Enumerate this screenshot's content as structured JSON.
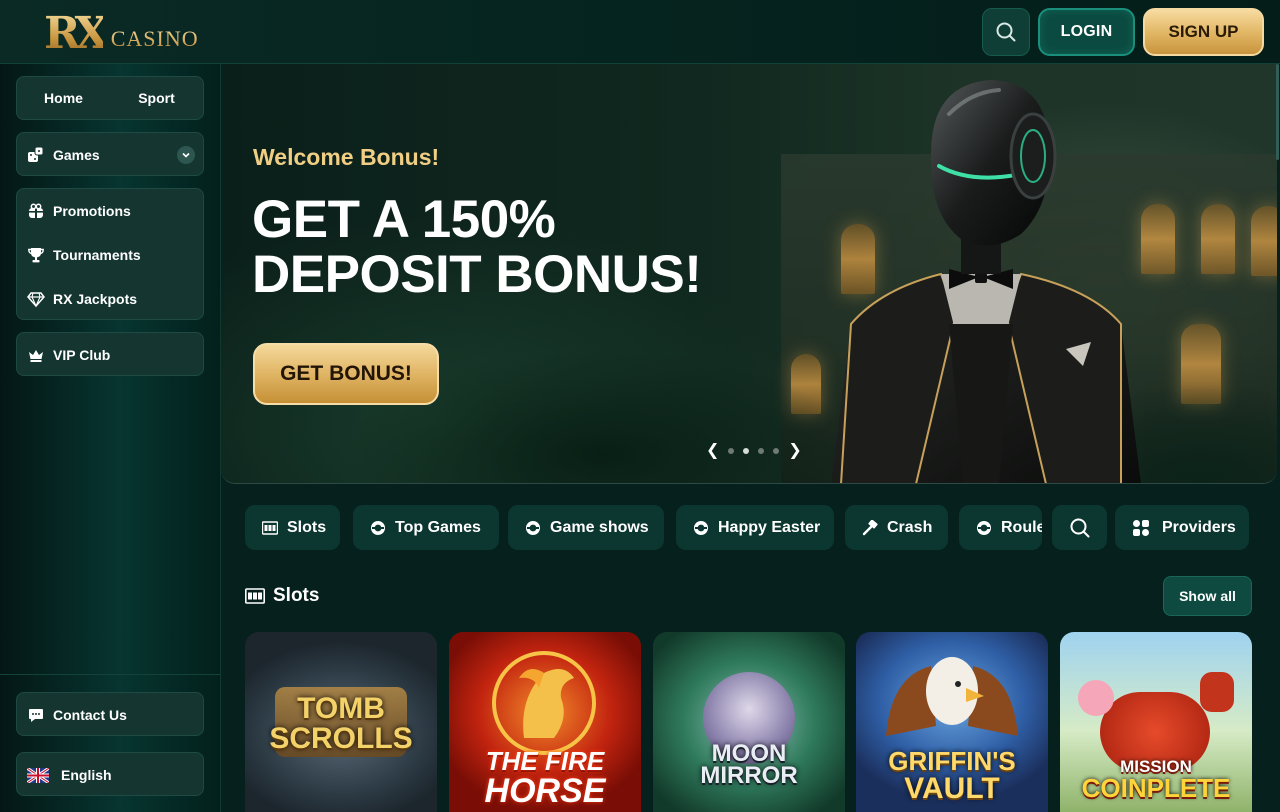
{
  "header": {
    "logo_rx": "RX",
    "logo_text": "CASINO",
    "login_label": "LOGIN",
    "signup_label": "SIGN UP"
  },
  "sidebar": {
    "home_label": "Home",
    "sport_label": "Sport",
    "games_label": "Games",
    "items": [
      {
        "label": "Promotions",
        "icon": "gift-icon"
      },
      {
        "label": "Tournaments",
        "icon": "trophy-icon"
      },
      {
        "label": "RX Jackpots",
        "icon": "diamond-icon"
      }
    ],
    "vip_label": "VIP Club",
    "contact_label": "Contact Us",
    "language_label": "English"
  },
  "hero": {
    "eyebrow": "Welcome Bonus!",
    "title_line1": "GET A 150%",
    "title_line2": "DEPOSIT BONUS!",
    "cta_label": "GET BONUS!",
    "slide_count": 4,
    "active_slide": 2
  },
  "tabs": [
    {
      "label": "Slots",
      "icon": "slot-machine-icon"
    },
    {
      "label": "Top Games",
      "icon": "chip-icon"
    },
    {
      "label": "Game shows",
      "icon": "chip-icon"
    },
    {
      "label": "Happy Easter",
      "icon": "chip-icon"
    },
    {
      "label": "Crash",
      "icon": "hammer-icon"
    },
    {
      "label": "Roule",
      "icon": "chip-icon"
    }
  ],
  "providers_label": "Providers",
  "slots_section": {
    "title": "Slots",
    "show_all_label": "Show all",
    "games": [
      {
        "line1": "TOMB",
        "line2": "SCROLLS"
      },
      {
        "line1": "THE FIRE",
        "line2": "HORSE"
      },
      {
        "line1": "MOON",
        "line2": "MIRROR"
      },
      {
        "line1": "GRIFFIN'S",
        "line2": "VAULT"
      },
      {
        "line1": "MISSION",
        "line2": "COINPLETE"
      }
    ]
  },
  "colors": {
    "background": "#06211d",
    "accent_gold": "#e0b565",
    "accent_teal": "#1a8f7c",
    "tab_bg": "#0c3630"
  }
}
